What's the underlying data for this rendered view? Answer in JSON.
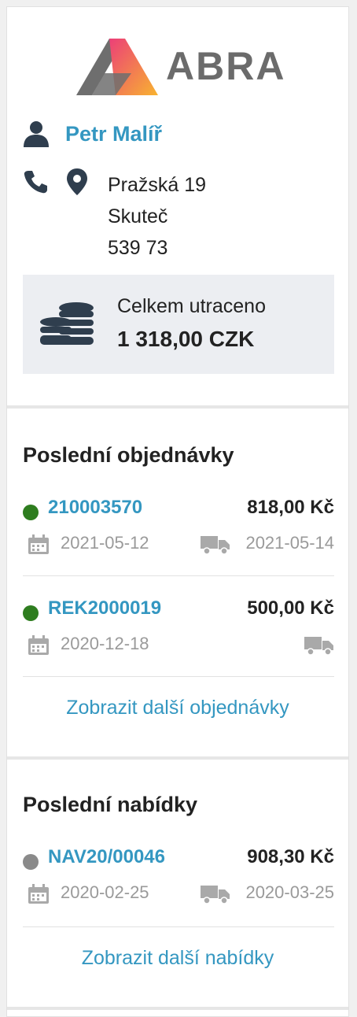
{
  "brand": {
    "logo_text": "ABRA"
  },
  "customer": {
    "name": "Petr Malíř",
    "address": [
      "Pražská 19",
      "Skuteč",
      "539 73"
    ]
  },
  "spent": {
    "label": "Celkem utraceno",
    "value": "1 318,00 CZK"
  },
  "orders": {
    "title": "Poslední objednávky",
    "items": [
      {
        "number": "210003570",
        "amount": "818,00 Kč",
        "date": "2021-05-12",
        "delivery_date": "2021-05-14",
        "status_color": "#2e7d1f"
      },
      {
        "number": "REK2000019",
        "amount": "500,00 Kč",
        "date": "2020-12-18",
        "delivery_date": "",
        "status_color": "#2e7d1f"
      }
    ],
    "more_label": "Zobrazit další objednávky"
  },
  "offers": {
    "title": "Poslední nabídky",
    "items": [
      {
        "number": "NAV20/00046",
        "amount": "908,30 Kč",
        "date": "2020-02-25",
        "delivery_date": "2020-03-25",
        "status_color": "#8a8a8a"
      }
    ],
    "more_label": "Zobrazit další nabídky"
  },
  "colors": {
    "link": "#3497c1",
    "icon": "#2f3e4e",
    "muted": "#9a9a9a"
  }
}
